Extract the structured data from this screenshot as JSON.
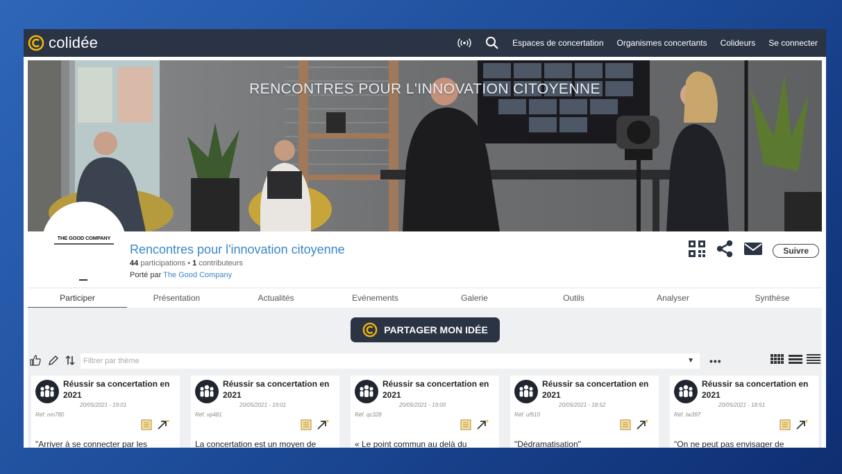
{
  "header": {
    "brand": "colidée",
    "icons": [
      "broadcast-icon",
      "search-icon"
    ],
    "nav": [
      "Espaces de concertation",
      "Organismes concertants",
      "Colideurs",
      "Se connecter"
    ]
  },
  "banner": {
    "title": "RENCONTRES POUR L'INNOVATION CITOYENNE"
  },
  "profile": {
    "logo_text": "THE GOOD COMPANY",
    "title": "Rencontres pour l'innovation citoyenne",
    "participations_count": "44",
    "participations_label": "participations",
    "separator": "•",
    "contributors_count": "1",
    "contributors_label": "contributeurs",
    "owner_prefix": "Porté par",
    "owner_name": "The Good Company",
    "actions": [
      "qr-code-icon",
      "share-icon",
      "mail-icon"
    ],
    "follow_label": "Suivre"
  },
  "tabs": [
    "Participer",
    "Présentation",
    "Actualités",
    "Evénements",
    "Galerie",
    "Outils",
    "Analyser",
    "Synthèse"
  ],
  "active_tab": "Participer",
  "cta": {
    "label": "PARTAGER MON IDÉE"
  },
  "filter": {
    "placeholder": "Filtrer par thème",
    "tool_icons": [
      "thumbs-up-icon",
      "pencil-icon",
      "sort-icon"
    ],
    "more": "•••",
    "view_icons": [
      "grid-view-icon",
      "list-view-icon",
      "compact-view-icon"
    ]
  },
  "cards": [
    {
      "title": "Réussir sa concertation en 2021",
      "date": "20/05/2021 - 19:01",
      "ref": "Réf. nm780",
      "excerpt": "\"Arriver à se connecter par les"
    },
    {
      "title": "Réussir sa concertation en 2021",
      "date": "20/05/2021 - 19:01",
      "ref": "Réf. vp481",
      "excerpt": "La concertation est un moyen de"
    },
    {
      "title": "Réussir sa concertation en 2021",
      "date": "20/05/2021 - 19:00",
      "ref": "Réf. qc328",
      "excerpt": "« Le point commun au delà du"
    },
    {
      "title": "Réussir sa concertation en 2021",
      "date": "20/05/2021 - 18:52",
      "ref": "Réf. uf910",
      "excerpt": "\"Dédramatisation\""
    },
    {
      "title": "Réussir sa concertation en 2021",
      "date": "20/05/2021 - 18:51",
      "ref": "Réf. tw397",
      "excerpt": "\"On ne peut pas envisager de"
    }
  ],
  "colors": {
    "frame_blue": "#1e4e9c",
    "header_bg": "#2b3445",
    "accent_yellow": "#f2b705",
    "link_blue": "#3a86c8",
    "content_bg": "#eef0f2"
  }
}
